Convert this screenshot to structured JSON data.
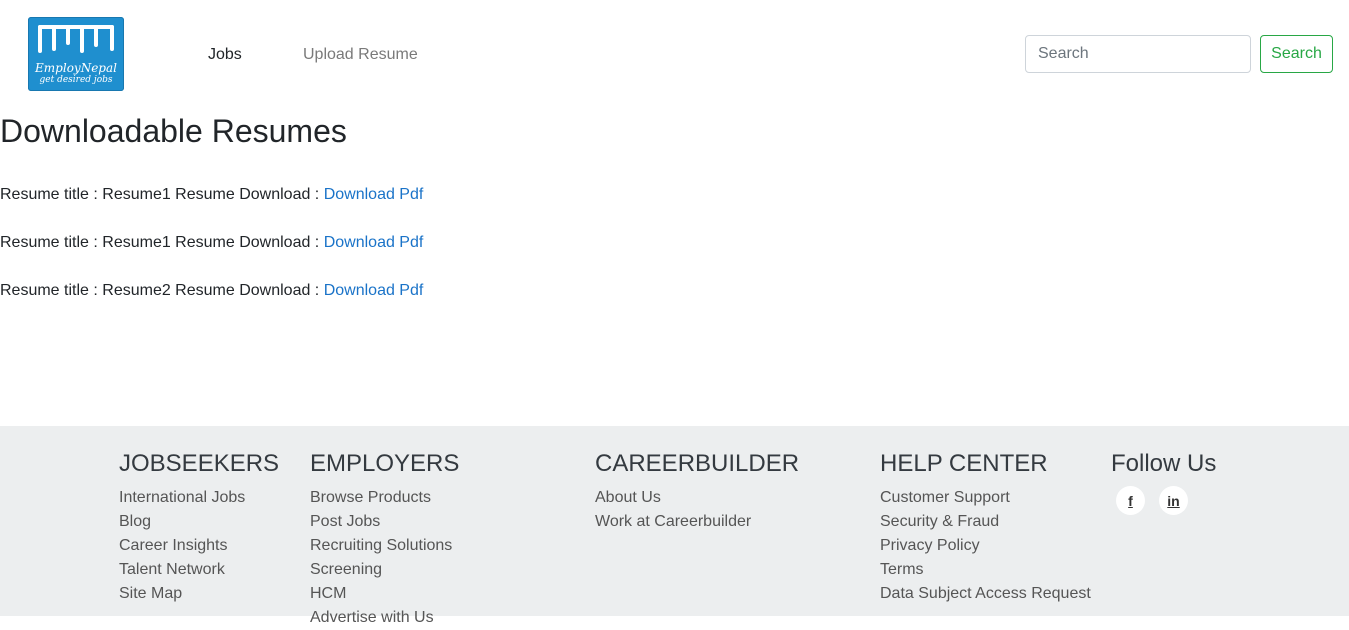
{
  "header": {
    "logo_name": "EmployNepal",
    "logo_tagline": "get desired jobs",
    "nav": {
      "jobs": "Jobs",
      "upload_resume": "Upload Resume"
    },
    "search": {
      "placeholder": "Search",
      "button": "Search"
    }
  },
  "main": {
    "title": "Downloadable Resumes",
    "resumes": [
      {
        "prefix": "Resume title : Resume1 Resume Download : ",
        "link": "Download Pdf"
      },
      {
        "prefix": "Resume title : Resume1 Resume Download : ",
        "link": "Download Pdf"
      },
      {
        "prefix": "Resume title : Resume2 Resume Download : ",
        "link": "Download Pdf"
      }
    ]
  },
  "footer": {
    "jobseekers": {
      "heading": "JOBSEEKERS",
      "links": [
        "International Jobs",
        "Blog",
        "Career Insights",
        "Talent Network",
        "Site Map"
      ]
    },
    "employers": {
      "heading": "EMPLOYERS",
      "links": [
        "Browse Products",
        "Post Jobs",
        "Recruiting Solutions",
        "Screening",
        "HCM",
        "Advertise with Us"
      ]
    },
    "careerbuilder": {
      "heading": "CAREERBUILDER",
      "links": [
        "About Us",
        "Work at Careerbuilder"
      ]
    },
    "help": {
      "heading": "HELP CENTER",
      "links": [
        "Customer Support",
        "Security & Fraud",
        "Privacy Policy",
        "Terms",
        "Data Subject Access Request"
      ]
    },
    "follow": {
      "heading": "Follow Us",
      "icons": [
        "facebook-icon",
        "linkedin-icon"
      ],
      "facebook_glyph": "f",
      "linkedin_glyph": "in"
    }
  },
  "colors": {
    "logo": "#1f8fcf",
    "link": "#1a73c8",
    "search_green": "#28a745",
    "footer_bg": "#eceeef"
  }
}
